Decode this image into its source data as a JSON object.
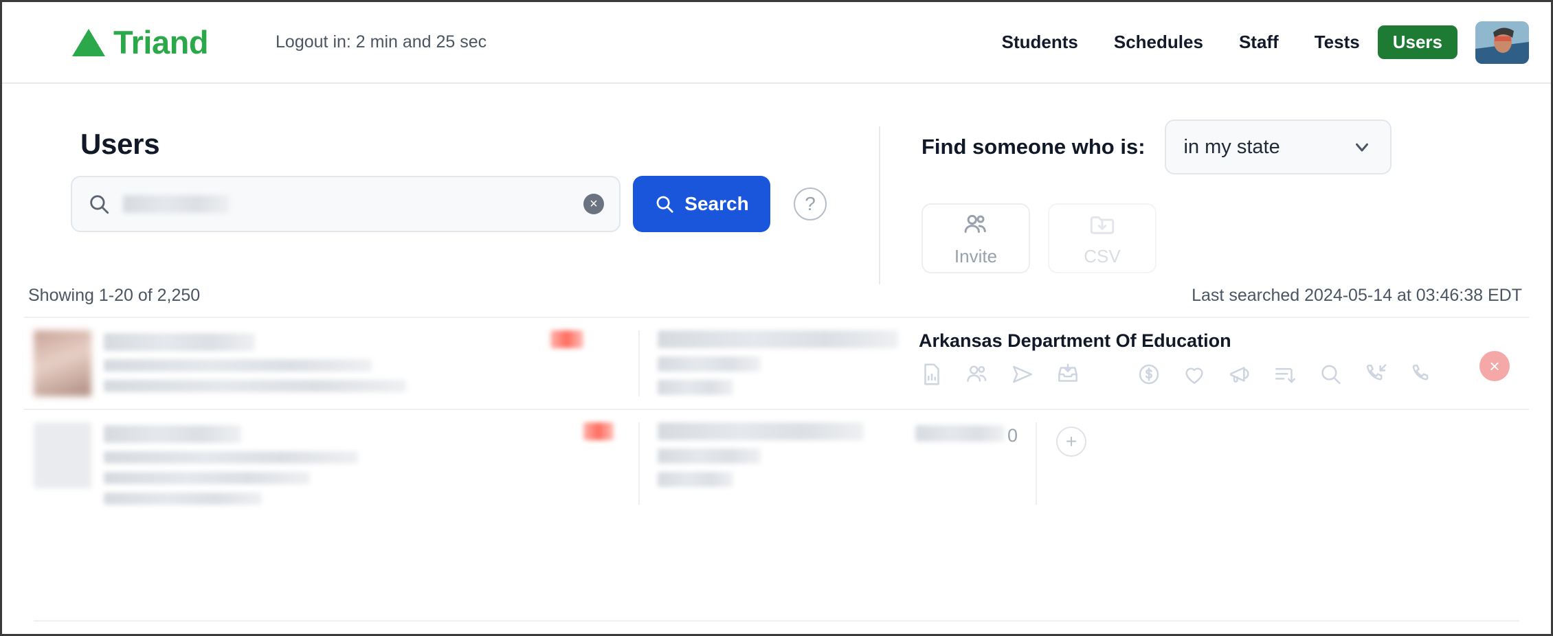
{
  "header": {
    "brand_name": "Triand",
    "brand_color": "#2aa84a",
    "logout_timer": "Logout in: 2 min and 25 sec",
    "nav_items": [
      {
        "label": "Students",
        "active": false
      },
      {
        "label": "Schedules",
        "active": false
      },
      {
        "label": "Staff",
        "active": false
      },
      {
        "label": "Tests",
        "active": false
      },
      {
        "label": "Users",
        "active": true
      }
    ],
    "active_nav_color": "#1e7b33",
    "avatar_name": "user-avatar"
  },
  "search": {
    "page_title": "Users",
    "input_value": "",
    "input_redacted": true,
    "search_button_label": "Search",
    "search_button_color": "#1a56db",
    "help_label": "?",
    "clear_label": "×"
  },
  "filter": {
    "label": "Find someone who is:",
    "selected_option": "in my state",
    "options": [
      "in my state"
    ],
    "buttons": [
      {
        "label": "Invite",
        "icon": "people-icon",
        "disabled": false
      },
      {
        "label": "CSV",
        "icon": "folder-download-icon",
        "disabled": true
      }
    ]
  },
  "results": {
    "showing_text": "Showing 1-20 of 2,250",
    "last_searched_text": "Last searched 2024-05-14 at 03:46:38 EDT",
    "rows": [
      {
        "org_name": "Arkansas Department Of Education",
        "count": null,
        "redacted": true,
        "close_label": "×",
        "actions": [
          "report-file-icon",
          "people-icon",
          "send-icon",
          "inbox-download-icon",
          "dollar-circle-icon",
          "heart-icon",
          "megaphone-icon",
          "sort-descending-icon",
          "search-icon",
          "incoming-call-icon",
          "phone-icon"
        ]
      },
      {
        "org_name": "",
        "count": "0",
        "redacted": true,
        "add_label": "+",
        "actions": []
      }
    ]
  }
}
